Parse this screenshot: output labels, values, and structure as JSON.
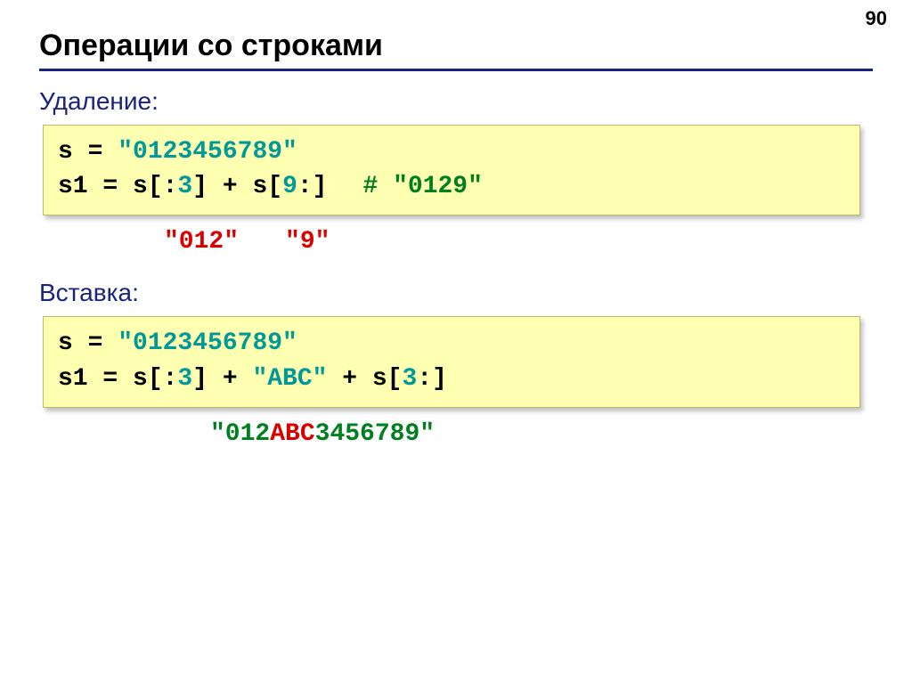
{
  "page_number": "90",
  "title": "Операции со строками",
  "sections": {
    "deletion": {
      "label": "Удаление:",
      "code": {
        "line1_a": "s = ",
        "line1_b": "\"0123456789\"",
        "line2_a": "s1 = s[:",
        "line2_b": "3",
        "line2_c": "] + s[",
        "line2_d": "9",
        "line2_e": ":]",
        "comment": "# \"0129\""
      },
      "hint": {
        "part1": "\"012\"",
        "part2": "\"9\""
      }
    },
    "insertion": {
      "label": "Вставка:",
      "code": {
        "line1_a": "s = ",
        "line1_b": "\"0123456789\"",
        "line2_a": "s1 = s[:",
        "line2_b": "3",
        "line2_c": "] + ",
        "line2_d": "\"ABC\"",
        "line2_e": " + s[",
        "line2_f": "3",
        "line2_g": ":]"
      },
      "hint": {
        "pre": "\"012",
        "mid": "ABC",
        "post": "3456789\""
      }
    }
  }
}
